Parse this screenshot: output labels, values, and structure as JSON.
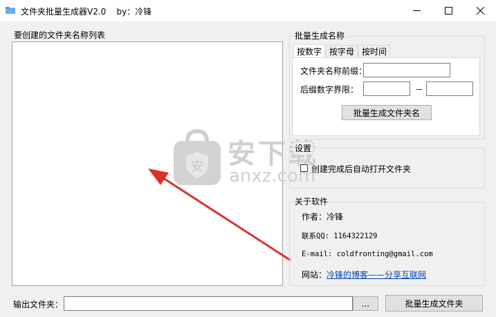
{
  "window": {
    "title": "文件夹批量生成器V2.0    by：冷锋"
  },
  "list_panel": {
    "label": "要创建的文件夹名称列表",
    "content": ""
  },
  "batch_group": {
    "title": "批量生成名称",
    "tabs": [
      "按数字",
      "按字母",
      "按时间"
    ],
    "active_tab": "按数字",
    "prefix_label": "文件夹名称前缀：",
    "prefix_value": "",
    "range_label": "后缀数字界限：",
    "range_from": "",
    "range_sep": "－",
    "range_to": "",
    "generate_button": "批量生成文件夹名"
  },
  "settings_group": {
    "title": "设置",
    "auto_open_label": "创建完成后自动打开文件夹",
    "auto_open_checked": false
  },
  "about_group": {
    "title": "关于软件",
    "author": "作者：冷锋",
    "qq": "联系QQ: 1164322129",
    "email": "E-mail: coldfronting@gmail.com",
    "site_label": "网站：",
    "site_link": "冷锋的博客——分享互联网"
  },
  "bottom": {
    "output_label": "输出文件夹：",
    "output_value": "",
    "browse_button": "...",
    "create_button": "批量生成文件夹"
  },
  "watermark": {
    "brand": "安下载",
    "domain": "anxz.com"
  },
  "colors": {
    "arrow": "#d9322b",
    "link": "#0645ad"
  }
}
